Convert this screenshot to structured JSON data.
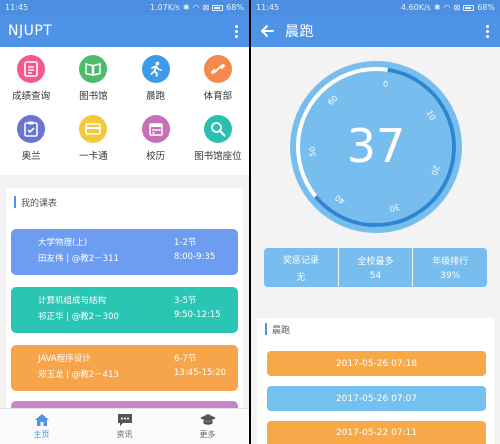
{
  "left": {
    "status": {
      "time": "11:45",
      "speed": "1.07K/s",
      "battery": "68%"
    },
    "appbar": {
      "title": "NJUPT"
    },
    "grid": [
      {
        "label": "成绩查询",
        "icon": "grades-icon",
        "color": "#f15a8a"
      },
      {
        "label": "图书馆",
        "icon": "library-book-icon",
        "color": "#4cbb6c"
      },
      {
        "label": "晨跑",
        "icon": "runner-icon",
        "color": "#3f9be8"
      },
      {
        "label": "体育部",
        "icon": "dumbbell-icon",
        "color": "#f5894b"
      },
      {
        "label": "奥兰",
        "icon": "clipboard-check-icon",
        "color": "#6a74d6"
      },
      {
        "label": "一卡通",
        "icon": "card-icon",
        "color": "#f4c83d"
      },
      {
        "label": "校历",
        "icon": "calendar-icon",
        "color": "#c76fb8"
      },
      {
        "label": "图书馆座位",
        "icon": "search-icon",
        "color": "#2bbfae"
      }
    ],
    "schedule": {
      "title": "我的课表",
      "courses": [
        {
          "name": "大学物理(上)",
          "teacher": "田友伟 | @教2－311",
          "period": "1-2节",
          "time": "8:00-9:35",
          "color": "#6c9df1"
        },
        {
          "name": "计算机组成与结构",
          "teacher": "祁正华 | @教2－300",
          "period": "3-5节",
          "time": "9:50-12:15",
          "color": "#2bc5b4"
        },
        {
          "name": "JAVA程序设计",
          "teacher": "邓玉龙 | @教2－413",
          "period": "6-7节",
          "time": "13:45-15:20",
          "color": "#f7a54a"
        }
      ]
    },
    "tabs": [
      {
        "label": "主页",
        "icon": "home-icon"
      },
      {
        "label": "资讯",
        "icon": "chat-icon"
      },
      {
        "label": "更多",
        "icon": "graduation-cap-icon"
      }
    ]
  },
  "right": {
    "status": {
      "time": "11:45",
      "speed": "4.60K/s",
      "battery": "68%"
    },
    "appbar": {
      "title": "晨跑"
    },
    "dial": {
      "value": "37",
      "ticks": [
        "0",
        "10",
        "20",
        "30",
        "40",
        "50",
        "60"
      ],
      "progress": 0.617
    },
    "stats": [
      {
        "label": "奖惩记录",
        "value": "无"
      },
      {
        "label": "全校最多",
        "value": "54"
      },
      {
        "label": "年级排行",
        "value": "39%"
      }
    ],
    "runs": {
      "title": "晨跑",
      "records": [
        {
          "time": "2017-05-26 07:18",
          "color": "#f7a94a"
        },
        {
          "time": "2017-05-26 07:07",
          "color": "#74c1ef"
        },
        {
          "time": "2017-05-22 07:11",
          "color": "#f7a94a"
        }
      ]
    }
  },
  "colors": {
    "primary": "#4e93e5",
    "dial_fill": "#77bdee",
    "dial_arc": "#2e86d3"
  }
}
